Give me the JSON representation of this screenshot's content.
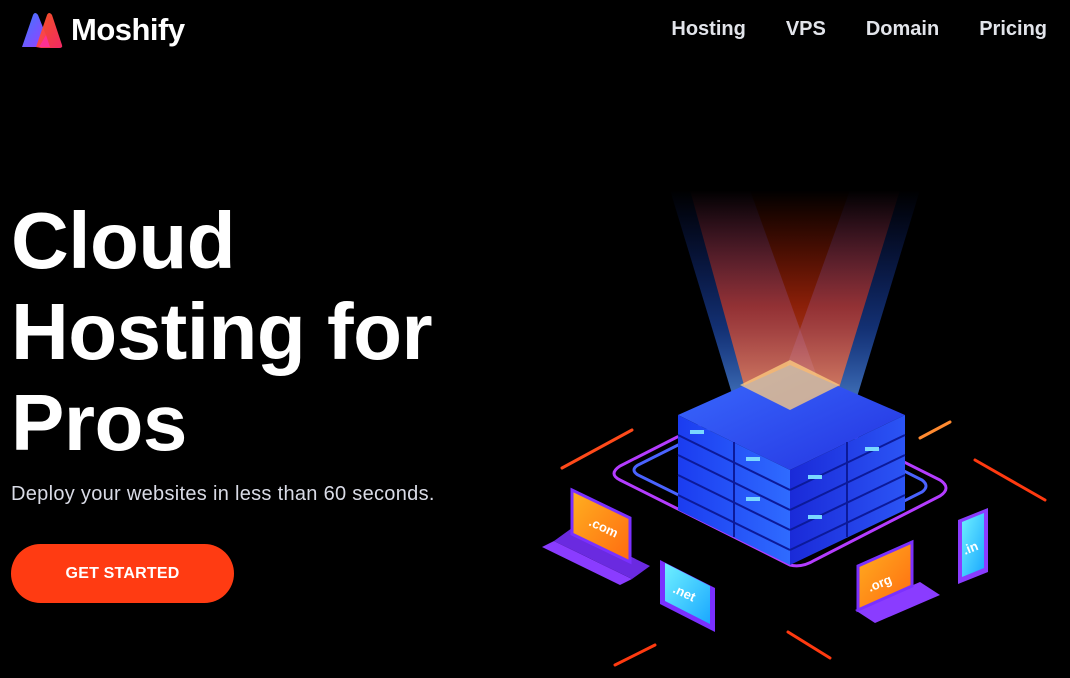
{
  "brand": {
    "name": "Moshify",
    "accent": "#ff3b12"
  },
  "nav": {
    "items": [
      "Hosting",
      "VPS",
      "Domain",
      "Pricing"
    ]
  },
  "hero": {
    "title_lines": [
      "Cloud",
      "Hosting for",
      "Pros"
    ],
    "subtitle": "Deploy your websites in less than 60 seconds.",
    "cta_label": "GET STARTED"
  },
  "illustration": {
    "devices": [
      {
        "label": ".com",
        "kind": "laptop"
      },
      {
        "label": ".net",
        "kind": "tablet"
      },
      {
        "label": ".org",
        "kind": "laptop"
      },
      {
        "label": ".in",
        "kind": "phone"
      }
    ]
  }
}
